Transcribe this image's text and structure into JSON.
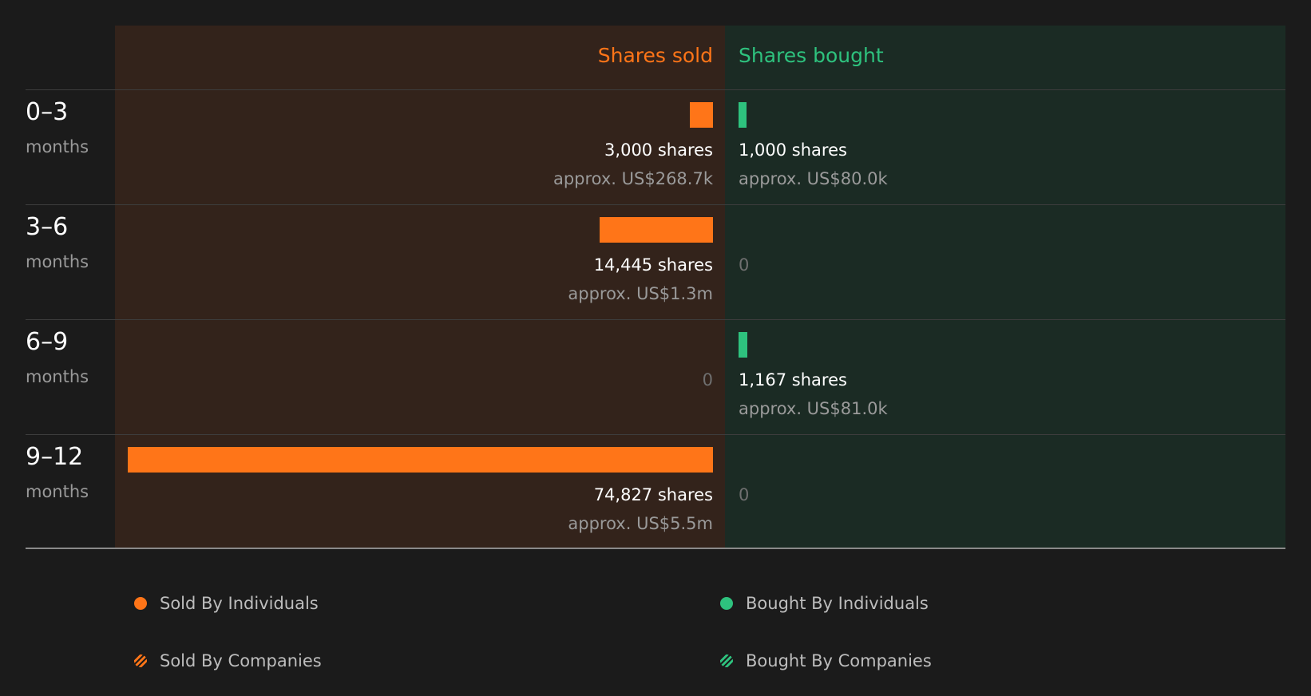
{
  "colors": {
    "sold": "#ff7518",
    "bought": "#2ec27e"
  },
  "headers": {
    "sold": "Shares sold",
    "bought": "Shares bought"
  },
  "rows": [
    {
      "period": "0–3",
      "unit": "months",
      "sold_label": "3,000 shares",
      "sold_approx": "approx. US$268.7k",
      "bought_label": "1,000 shares",
      "bought_approx": "approx. US$80.0k"
    },
    {
      "period": "3–6",
      "unit": "months",
      "sold_label": "14,445 shares",
      "sold_approx": "approx. US$1.3m",
      "bought_label": "0",
      "bought_approx": ""
    },
    {
      "period": "6–9",
      "unit": "months",
      "sold_label": "0",
      "sold_approx": "",
      "bought_label": "1,167 shares",
      "bought_approx": "approx. US$81.0k"
    },
    {
      "period": "9–12",
      "unit": "months",
      "sold_label": "74,827 shares",
      "sold_approx": "approx. US$5.5m",
      "bought_label": "0",
      "bought_approx": ""
    }
  ],
  "legend": [
    {
      "label": "Sold By Individuals",
      "style": "solid",
      "color": "#ff7518"
    },
    {
      "label": "Bought By Individuals",
      "style": "solid",
      "color": "#2ec27e"
    },
    {
      "label": "Sold By Companies",
      "style": "hatched",
      "color": "#ff7518"
    },
    {
      "label": "Bought By Companies",
      "style": "hatched",
      "color": "#2ec27e"
    }
  ],
  "chart_data": {
    "type": "bar",
    "orientation": "horizontal-diverging",
    "categories": [
      "0–3",
      "3–6",
      "6–9",
      "9–12"
    ],
    "category_unit": "months",
    "series": [
      {
        "name": "Shares sold",
        "values": [
          3000,
          14445,
          0,
          74827
        ]
      },
      {
        "name": "Shares bought",
        "values": [
          1000,
          0,
          1167,
          0
        ]
      }
    ],
    "approx_value": {
      "sold": [
        "approx. US$268.7k",
        "approx. US$1.3m",
        "",
        "approx. US$5.5m"
      ],
      "bought": [
        "approx. US$80.0k",
        "",
        "approx. US$81.0k",
        ""
      ]
    },
    "legend_placement": "bottom"
  }
}
